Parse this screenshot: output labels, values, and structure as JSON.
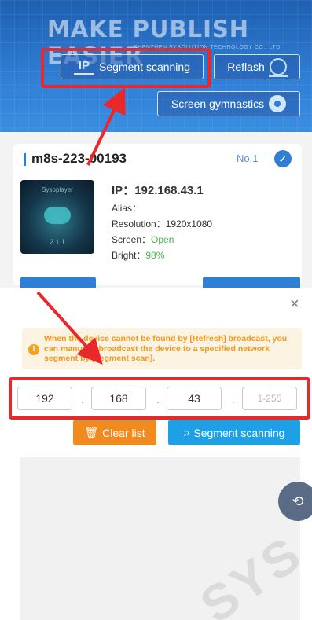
{
  "header": {
    "slogan": "MAKE PUBLISH EASIER",
    "company": "SHENZHEN SYSOLUTION TECHNOLOGY CO., LTD",
    "buttons": {
      "segment_scanning": "Segment scanning",
      "reflash": "Reflash",
      "screen_gymnastics": "Screen gymnastics"
    }
  },
  "device": {
    "name": "m8s-223-00193",
    "number": "No.1",
    "thumb_app": "Sysoplayer",
    "thumb_version": "2.1.1",
    "ip_label": "IP：",
    "ip": "192.168.43.1",
    "alias_label": "Alias：",
    "resolution_label": "Resolution：",
    "resolution": "1920x1080",
    "screen_label": "Screen：",
    "screen": "Open",
    "bright_label": "Bright：",
    "bright": "98%"
  },
  "sheet": {
    "close": "×",
    "tip": "When the device cannot be found by [Refresh] broadcast, you can manually broadcast the device to a specified network segment by [segment scan].",
    "ip_parts": [
      "192",
      "168",
      "43",
      ""
    ],
    "last_placeholder": "1-255",
    "dot": ".",
    "clear_label": "Clear list",
    "scan_label": "Segment scanning"
  },
  "watermark": "SYS",
  "colors": {
    "accent": "#2f7fd6",
    "annotation_red": "#e8282b",
    "clear_orange": "#f18a1f",
    "scan_blue": "#1da0e6",
    "tip_text": "#ef9a1a"
  }
}
